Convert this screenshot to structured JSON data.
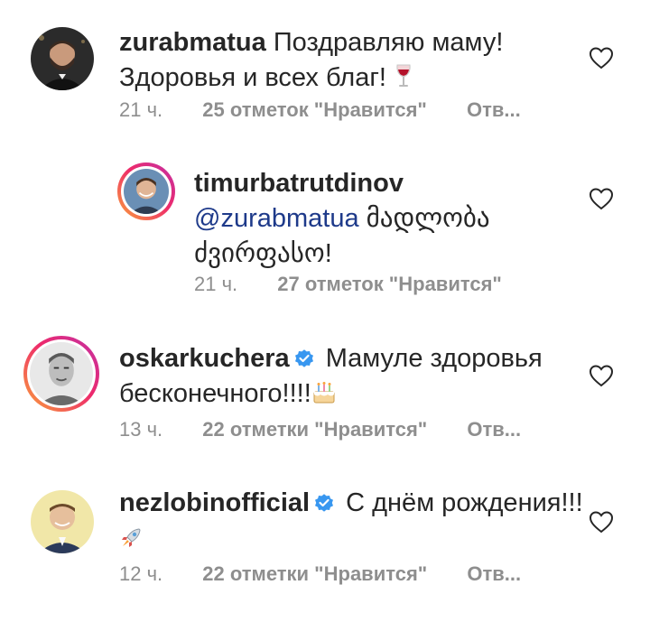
{
  "comments": [
    {
      "username": "zurabmatua",
      "text_line1": "Поздравляю маму!",
      "text_line2": "Здоровья и всех благ!",
      "emoji": "wine-glass",
      "time": "21 ч.",
      "likes": "25 отметок \"Нравится\"",
      "reply": "Отв..."
    },
    {
      "username": "timurbatrutdinov",
      "mention": "@zurabmatua",
      "text_line1": "მადლობა",
      "text_line2": "ძვირფასო!",
      "time": "21 ч.",
      "likes": "27 отметок \"Нравится\""
    },
    {
      "username": "oskarkuchera",
      "verified": true,
      "text_line1": "Мамуле здоровья",
      "text_line2": "бесконечного!!!!",
      "emoji": "birthday-cake",
      "time": "13 ч.",
      "likes": "22 отметки \"Нравится\"",
      "reply": "Отв..."
    },
    {
      "username": "nezlobinofficial",
      "verified": true,
      "text_line1": "С днём рождения!!!",
      "emoji": "rocket",
      "time": "12 ч.",
      "likes": "22 отметки \"Нравится\"",
      "reply": "Отв..."
    }
  ],
  "colors": {
    "text": "#262626",
    "meta": "#8e8e8e",
    "mention": "#1e3a8a",
    "verified": "#3897f0"
  }
}
